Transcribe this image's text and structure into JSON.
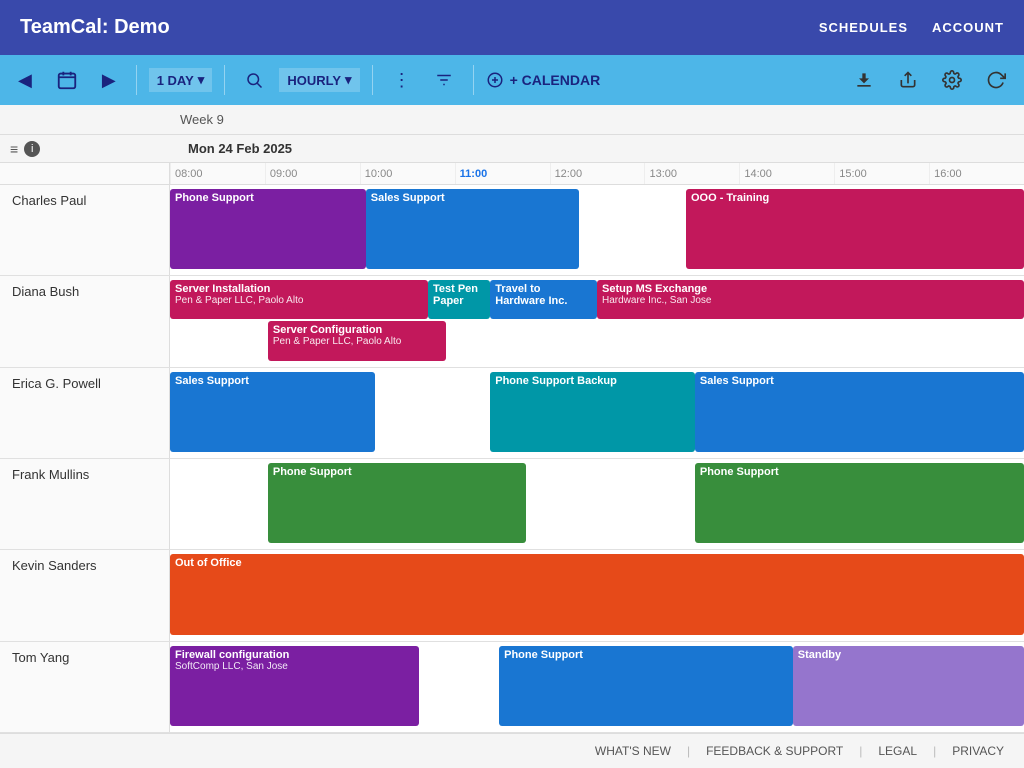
{
  "app": {
    "title": "TeamCal:  Demo",
    "nav_schedules": "SCHEDULES",
    "nav_account": "ACCOUNT"
  },
  "toolbar": {
    "prev_icon": "◀",
    "calendar_icon": "📅",
    "next_icon": "▶",
    "day_view": "1 DAY",
    "hourly_view": "HOURLY",
    "more_icon": "⋮",
    "search_icon": "🔍",
    "filter_icon": "▼",
    "add_calendar": "+ CALENDAR",
    "download_icon": "⬇",
    "share_icon": "⤴",
    "settings_icon": "⚙",
    "refresh_icon": "↺"
  },
  "calendar": {
    "week_label": "Week 9",
    "date_label": "Mon 24 Feb 2025",
    "time_slots": [
      "08:00",
      "09:00",
      "10:00",
      "11:00",
      "12:00",
      "13:00",
      "14:00",
      "15:00",
      "16:00"
    ],
    "highlight_time": "11:00"
  },
  "people": [
    {
      "name": "Charles Paul",
      "events": [
        {
          "title": "Phone Support",
          "subtitle": "",
          "color": "purple",
          "start": 0,
          "end": 110
        },
        {
          "title": "Sales Support",
          "subtitle": "",
          "color": "blue",
          "start": 110,
          "end": 230
        },
        {
          "title": "OOO - Training",
          "subtitle": "",
          "color": "pink",
          "start": 290,
          "end": 480
        }
      ]
    },
    {
      "name": "Diana Bush",
      "events": [
        {
          "title": "Server Installation",
          "subtitle": "Pen & Paper LLC, Paolo Alto",
          "color": "pink",
          "start": 0,
          "end": 145,
          "row": "first"
        },
        {
          "title": "Test Pen Paper",
          "subtitle": "",
          "color": "teal",
          "start": 145,
          "end": 180,
          "row": "first"
        },
        {
          "title": "Travel to Hardware Inc.",
          "subtitle": "",
          "color": "blue",
          "start": 180,
          "end": 240,
          "row": "first"
        },
        {
          "title": "Setup MS Exchange",
          "subtitle": "Hardware Inc., San Jose",
          "color": "pink",
          "start": 240,
          "end": 480,
          "row": "first"
        },
        {
          "title": "Server Configuration",
          "subtitle": "Pen & Paper LLC, Paolo Alto",
          "color": "pink",
          "start": 55,
          "end": 155,
          "row": "second"
        }
      ]
    },
    {
      "name": "Erica G. Powell",
      "events": [
        {
          "title": "Sales Support",
          "subtitle": "",
          "color": "blue",
          "start": 0,
          "end": 115
        },
        {
          "title": "Phone Support Backup",
          "subtitle": "",
          "color": "teal",
          "start": 180,
          "end": 295
        },
        {
          "title": "Sales Support",
          "subtitle": "",
          "color": "blue",
          "start": 295,
          "end": 480
        }
      ]
    },
    {
      "name": "Frank Mullins",
      "events": [
        {
          "title": "Phone Support",
          "subtitle": "",
          "color": "green",
          "start": 55,
          "end": 200
        },
        {
          "title": "Phone Support",
          "subtitle": "",
          "color": "green",
          "start": 295,
          "end": 480
        }
      ]
    },
    {
      "name": "Kevin Sanders",
      "events": [
        {
          "title": "Out of Office",
          "subtitle": "",
          "color": "red",
          "start": 0,
          "end": 480
        }
      ]
    },
    {
      "name": "Tom Yang",
      "events": [
        {
          "title": "Firewall configuration",
          "subtitle": "SoftComp LLC, San Jose",
          "color": "purple",
          "start": 0,
          "end": 140
        },
        {
          "title": "Phone Support",
          "subtitle": "",
          "color": "blue",
          "start": 185,
          "end": 350
        },
        {
          "title": "Standby",
          "subtitle": "",
          "color": "lavender",
          "start": 350,
          "end": 480
        }
      ]
    }
  ],
  "footer": {
    "whats_new": "WHAT'S NEW",
    "feedback": "FEEDBACK & SUPPORT",
    "legal": "LEGAL",
    "privacy": "PRIVACY"
  }
}
